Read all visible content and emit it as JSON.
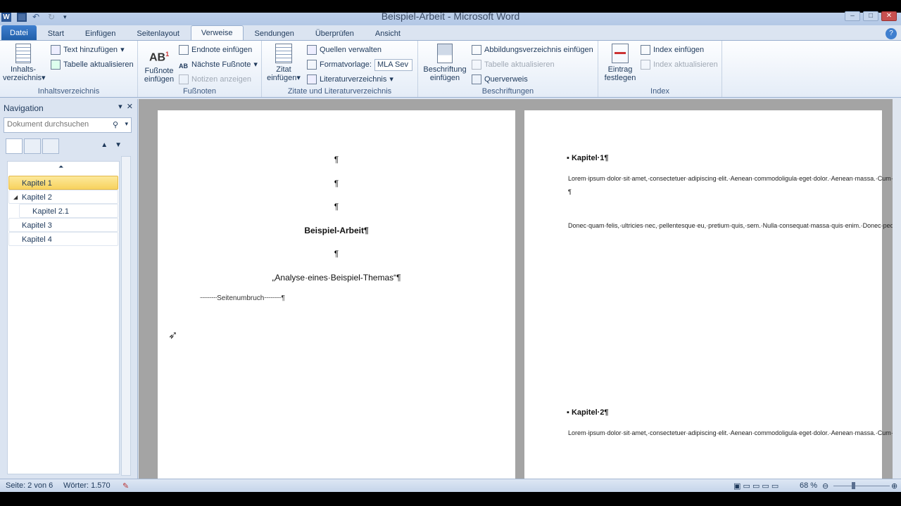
{
  "window": {
    "title": "Beispiel-Arbeit - Microsoft Word"
  },
  "tabs": [
    "Datei",
    "Start",
    "Einfügen",
    "Seitenlayout",
    "Verweise",
    "Sendungen",
    "Überprüfen",
    "Ansicht"
  ],
  "ribbon": {
    "toc": {
      "big_label": "Inhalts-\nverzeichnis",
      "add_text": "Text hinzufügen",
      "update": "Tabelle aktualisieren",
      "group": "Inhaltsverzeichnis"
    },
    "footnotes": {
      "big_label": "Fußnote\neinfügen",
      "endnote": "Endnote einfügen",
      "next": "Nächste Fußnote",
      "show": "Notizen anzeigen",
      "group": "Fußnoten"
    },
    "citations": {
      "big_label": "Zitat\neinfügen",
      "manage": "Quellen verwalten",
      "style_label": "Formatvorlage:",
      "style_value": "MLA Sev",
      "bibliography": "Literaturverzeichnis",
      "group": "Zitate und Literaturverzeichnis"
    },
    "captions": {
      "big_label": "Beschriftung\neinfügen",
      "tof": "Abbildungsverzeichnis einfügen",
      "update": "Tabelle aktualisieren",
      "crossref": "Querverweis",
      "group": "Beschriftungen"
    },
    "index": {
      "big_label": "Eintrag\nfestlegen",
      "insert": "Index einfügen",
      "update": "Index aktualisieren",
      "group": "Index"
    }
  },
  "nav": {
    "title": "Navigation",
    "search_placeholder": "Dokument durchsuchen",
    "items": [
      {
        "label": "Kapitel 1"
      },
      {
        "label": "Kapitel 2"
      },
      {
        "label": "Kapitel 2.1"
      },
      {
        "label": "Kapitel 3"
      },
      {
        "label": "Kapitel 4"
      }
    ]
  },
  "doc": {
    "pilcrow": "¶",
    "title": "Beispiel-Arbeit¶",
    "subtitle": "„Analyse·eines·Beispiel-Themas“¶",
    "pagebreak": "Seitenumbruch",
    "h1": "Kapitel·1¶",
    "p1": "Lorem·ipsum·dolor·sit·amet,·consectetuer·adipiscing·elit.·Aenean·commodoligula·eget·dolor.·Aenean·massa.·Cum·sociis·natoque·penatibus·et·magnis·dis·parturient·montes,·nascetur·ridiculus·mus.·{cvbn}¶",
    "p2": "Donec·quam·felis,·ultricies·nec,·pellentesque·eu,·pretium·quis,·sem.·Nulla·consequat·massa·quis·enim.·Donec·pede·justo,·fringilla·vel,·aliquet·nec,·vulputate·eget,·arcu.·In·enim·justo,·rhoncus·ut,·imperdiet·a,·venenatis·vitae,·justo.·Nullam·dictum·felis·eu·pede·mollis·pretium.·Integer·tincidunt.·Cras·dapibus.·Vivamus·elementum·semper·nisi.·Aenean·vulputate·eleifend·tellus.·Aenean·leo·ligula,·porttitor·eu,·consequat·vitae,·eleifend·ac,·enim.·Aliquam·lorem·ante,·dapibus·in,·viverra·quis,·feugiat·a,·tellus.·Phasellus·viverra·nulla·ut·metus·varius·laoreet.·Quisque·rutrum.·Aenean·imperdiet.·Etiam·ultricies·nisi·vel·augue.·Curabitur·ullamcorper·ultricies·nisi.·Nam·eget·dui.·Etiam·rhoncus.·Maecenas·tempus,·tellus·eget·condimentum·rhoncus,·sem·quam·semper·libero,·sit·amet·adipiscing·sem·neque·sed·ipsum.·Nam·quam·nunc,·blandit·vel,·luctus·pulvinar,·hendrerit·id,·lorem.·Maecenas·nec·odio·et·ante·tincidunt·tempus.·Donec·vitae·sapien·ut·libero·venenatis·faucibus.·Nullam·quis·ante.·Etiam·sit·amet·orci·eget·eros·faucibus·tincidunt.·Duis·leo.·Sed·fringilla·mauris·sit·amet·nibh.·Donec·sodales·sagittis·magna.·Sed·consequat,·leo·eget·bibendum·sodales,·augue·velit·cursus·nunc.¶",
    "h2": "Kapitel·2¶",
    "p3": "Lorem·ipsum·dolor·sit·amet,·consectetuer·adipiscing·elit.·Aenean·commodoligula·eget·dolor.·Aenean·massa.·Cum·sociis·natoque·penatibus·et·magnis·dis·parturient·montes,·nascetur·ridiculus·mus.·Donecquam·felis,·ultricies·nec,·pellentesque·eu,·pretium·quis,·sem.·Nulla·consequat·massa·quis·enim.·Donecpede·justo,·fringilla·vel,·aliquet·nec,·vulputate·eget,·arcu.·"
  },
  "status": {
    "page": "Seite: 2 von 6",
    "words": "Wörter: 1.570",
    "zoom": "68 %"
  }
}
